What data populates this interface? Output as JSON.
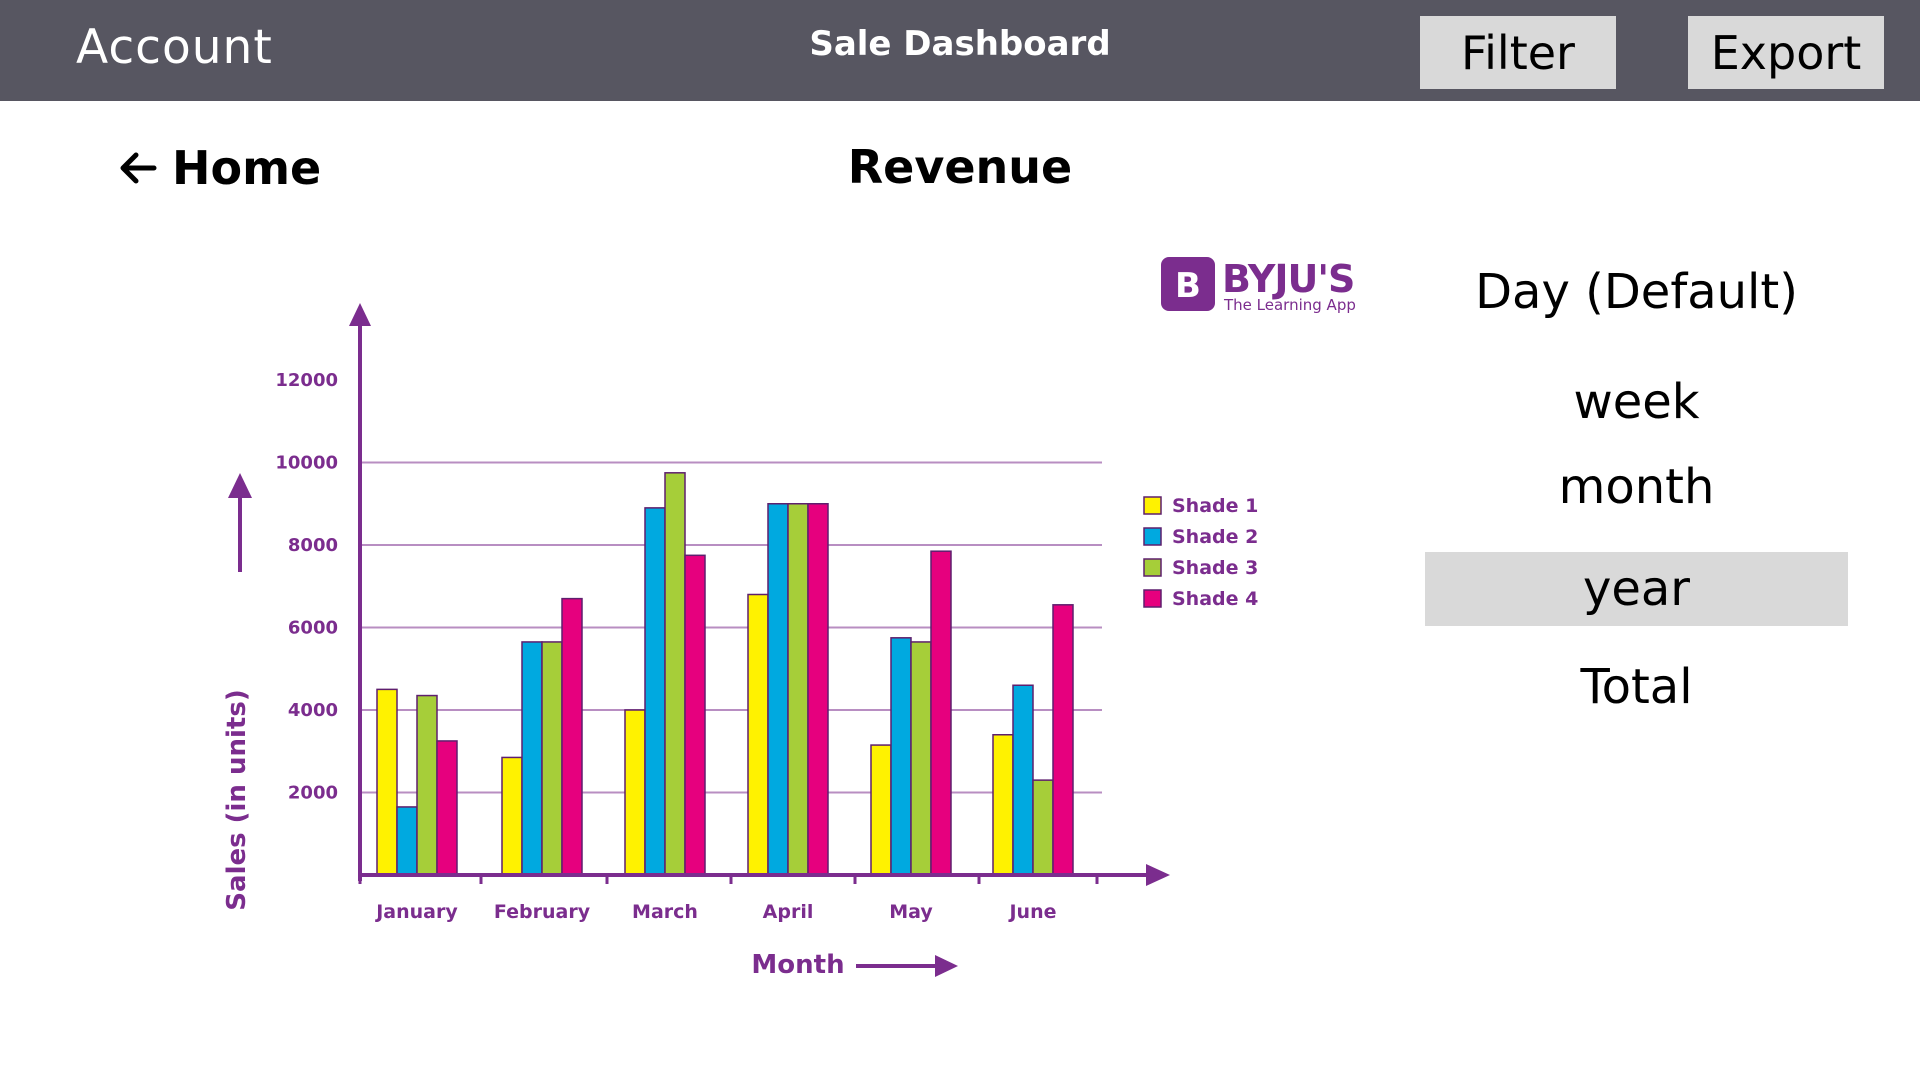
{
  "header": {
    "account_label": "Account",
    "title": "Sale Dashboard",
    "filter_label": "Filter",
    "export_label": "Export"
  },
  "nav": {
    "back_icon": "arrow-left-icon",
    "home_label": "Home"
  },
  "section": {
    "title": "Revenue"
  },
  "brand": {
    "name": "BYJU'S",
    "tagline": "The Learning App",
    "logo_letter": "B"
  },
  "periods": {
    "options": [
      "Day (Default)",
      "week",
      "month",
      "year",
      "Total"
    ],
    "selected": "year"
  },
  "colors": {
    "header_bg": "#575661",
    "button_bg": "#d9d9d9",
    "selected_bg": "#d9d9d9",
    "chart_accent": "#7b2d8e",
    "shade1": "#fff200",
    "shade2": "#00a9e0",
    "shade3": "#a6ce39",
    "shade4": "#e6007e"
  },
  "chart_data": {
    "type": "bar",
    "title": "",
    "xlabel": "Month",
    "ylabel": "Sales (in units)",
    "categories": [
      "January",
      "February",
      "March",
      "April",
      "May",
      "June"
    ],
    "yticks": [
      2000,
      4000,
      6000,
      8000,
      10000,
      12000
    ],
    "ylim": [
      0,
      12000
    ],
    "series": [
      {
        "name": "Shade 1",
        "color": "#fff200",
        "values": [
          4500,
          2850,
          4000,
          6800,
          3150,
          3400
        ]
      },
      {
        "name": "Shade 2",
        "color": "#00a9e0",
        "values": [
          1650,
          5650,
          8900,
          9000,
          5750,
          4600
        ]
      },
      {
        "name": "Shade 3",
        "color": "#a6ce39",
        "values": [
          4350,
          5650,
          9750,
          9000,
          5650,
          2300
        ]
      },
      {
        "name": "Shade 4",
        "color": "#e6007e",
        "values": [
          3250,
          6700,
          7750,
          9000,
          7850,
          6550
        ]
      }
    ],
    "legend_position": "right",
    "grid": true
  }
}
